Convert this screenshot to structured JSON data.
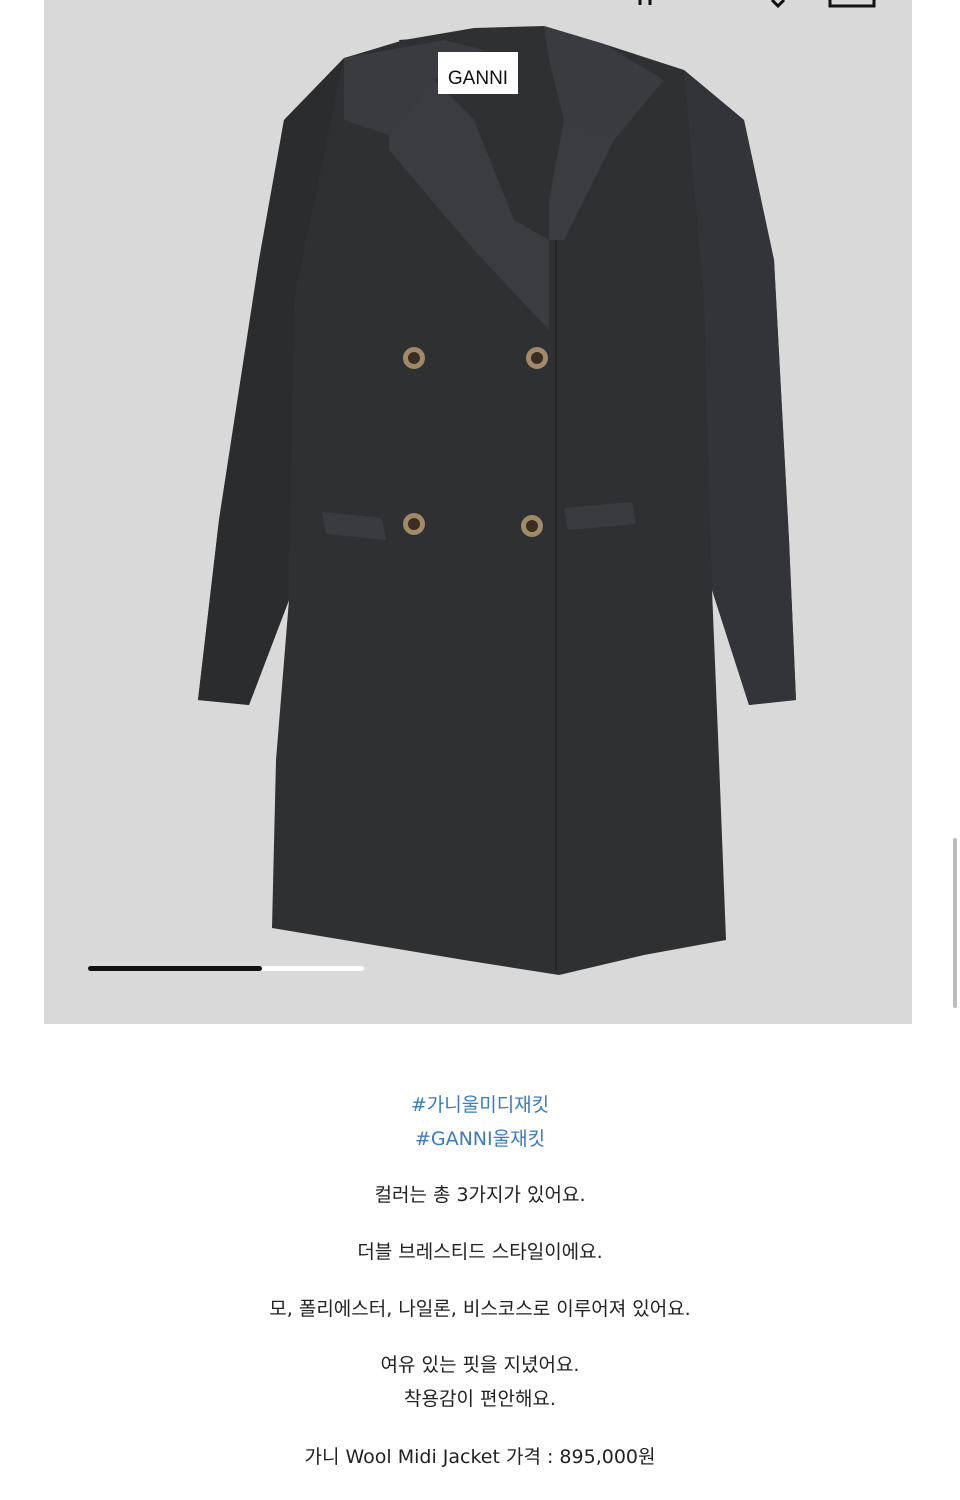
{
  "product": {
    "brand_label": "GANNI",
    "image_carousel": {
      "progress": 0.63
    }
  },
  "description": {
    "hashtags": [
      "#가니울미디재킷",
      "#GANNI울재킷"
    ],
    "lines": [
      "컬러는 총 3가지가 있어요.",
      "더블 브레스티드 스타일이에요.",
      "모, 폴리에스터, 나일론, 비스코스로 이루어져 있어요.",
      "여유 있는 핏을 지녔어요.",
      "착용감이 편안해요.",
      "가니 Wool Midi Jacket 가격 : 895,000원"
    ]
  },
  "colors": {
    "hero_bg": "#d9d9d9",
    "coat": "#2f3032",
    "hashtag": "#3b7bbf",
    "text": "#222222"
  }
}
